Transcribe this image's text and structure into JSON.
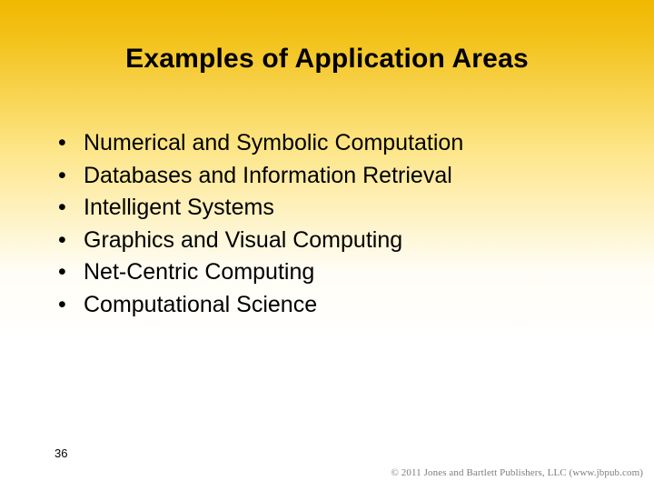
{
  "slide": {
    "title": "Examples of Application Areas",
    "bullets": [
      "Numerical and Symbolic Computation",
      "Databases and Information Retrieval",
      "Intelligent Systems",
      "Graphics and Visual Computing",
      "Net-Centric Computing",
      "Computational Science"
    ],
    "page_number": "36",
    "copyright": "© 2011 Jones and Bartlett Publishers, LLC (www.jbpub.com)"
  }
}
